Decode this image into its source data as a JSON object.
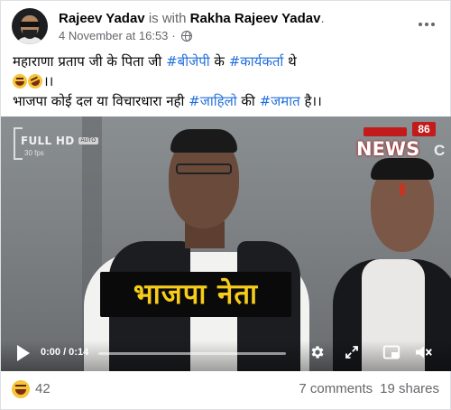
{
  "post": {
    "author": "Rajeev Yadav",
    "with_text": "is with",
    "tagged": "Rakha Rajeev Yadav",
    "tagged_suffix": ".",
    "timestamp": "4 November at 16:53",
    "separator": "·",
    "privacy_icon": "globe-icon",
    "text": {
      "line1_pre": "महाराणा प्रताप जी के पिता जी ",
      "tag1": "#बीजेपी",
      "line1_mid": " के ",
      "tag2": "#कार्यकर्ता",
      "line1_post": " थे",
      "line2_post": "।।",
      "line3_pre": "भाजपा कोई दल या विचारधारा नही ",
      "tag3": "#जाहिलो",
      "line3_mid": " की ",
      "tag4": "#जमात",
      "line3_post": " है।।"
    }
  },
  "video": {
    "quality_label": "FULL HD",
    "fps_label": "30 fps",
    "badge": "AUTO",
    "news_num": "86",
    "news_word": "NEWS",
    "news_c": "C",
    "caption": "भाजपा नेता",
    "time": "0:00 / 0:14",
    "progress": 0.0
  },
  "footer": {
    "reaction_icon": "laughing-emoji-icon",
    "reaction_count": "42",
    "comments": "7 comments",
    "shares": "19 shares"
  },
  "colors": {
    "hashtag": "#216fdb",
    "meta_grey": "#65676b",
    "caption_yellow": "#f7cd1a",
    "news_red": "#c21b1b"
  }
}
